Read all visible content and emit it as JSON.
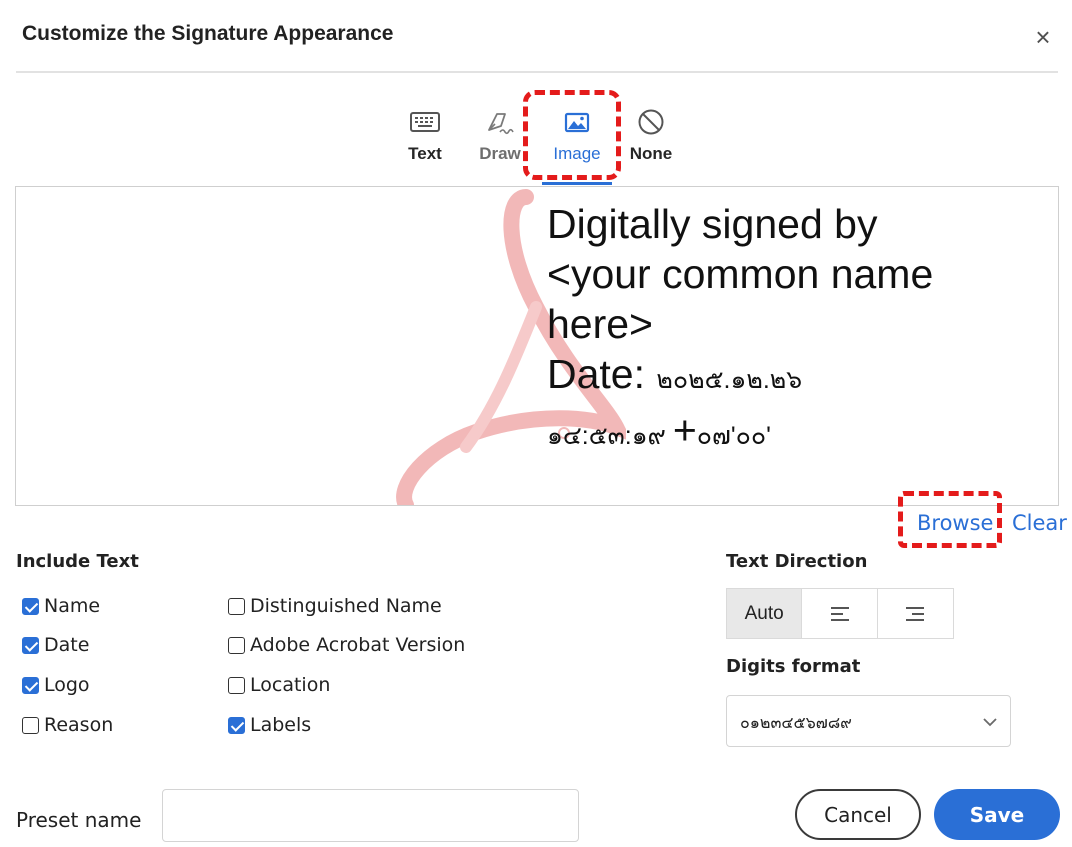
{
  "dialog": {
    "title": "Customize the Signature Appearance",
    "close_icon": "close-icon"
  },
  "tabs": [
    {
      "label": "Text",
      "icon": "keyboard-icon",
      "selected": false
    },
    {
      "label": "Draw",
      "icon": "pen-draw-icon",
      "selected": false
    },
    {
      "label": "Image",
      "icon": "image-icon",
      "selected": true
    },
    {
      "label": "None",
      "icon": "no-symbol-icon",
      "selected": false
    }
  ],
  "preview": {
    "watermark_icon": "acrobat-logo-watermark",
    "lines": [
      "Digitally signed by",
      "<your common name",
      "here>"
    ],
    "date_label": "Date: ",
    "date_value": "๒๐๒๕.๑๒.๒๖",
    "time_value": "๑๔:๕๓:๑๙ ",
    "tz_plus": "+",
    "tz_value": "๐๗'๐๐'"
  },
  "image_actions": {
    "browse_label": "Browse",
    "clear_label": "Clear"
  },
  "include_text": {
    "heading": "Include Text",
    "options": [
      {
        "label": "Name",
        "checked": true
      },
      {
        "label": "Date",
        "checked": true
      },
      {
        "label": "Logo",
        "checked": true
      },
      {
        "label": "Reason",
        "checked": false
      },
      {
        "label": "Distinguished Name",
        "checked": false
      },
      {
        "label": "Adobe Acrobat Version",
        "checked": false
      },
      {
        "label": "Location",
        "checked": false
      },
      {
        "label": "Labels",
        "checked": true
      }
    ]
  },
  "text_direction": {
    "heading": "Text Direction",
    "auto_label": "Auto",
    "options_icons": [
      "align-left-icon",
      "align-right-icon"
    ],
    "selected": "Auto"
  },
  "digits_format": {
    "heading": "Digits format",
    "selected_value": "๐๑๒๓๔๕๖๗๘๙"
  },
  "preset": {
    "label": "Preset name",
    "value": "",
    "placeholder": ""
  },
  "buttons": {
    "cancel_label": "Cancel",
    "save_label": "Save"
  },
  "colors": {
    "accent": "#2a6fd6",
    "highlight": "#e41b1b"
  }
}
